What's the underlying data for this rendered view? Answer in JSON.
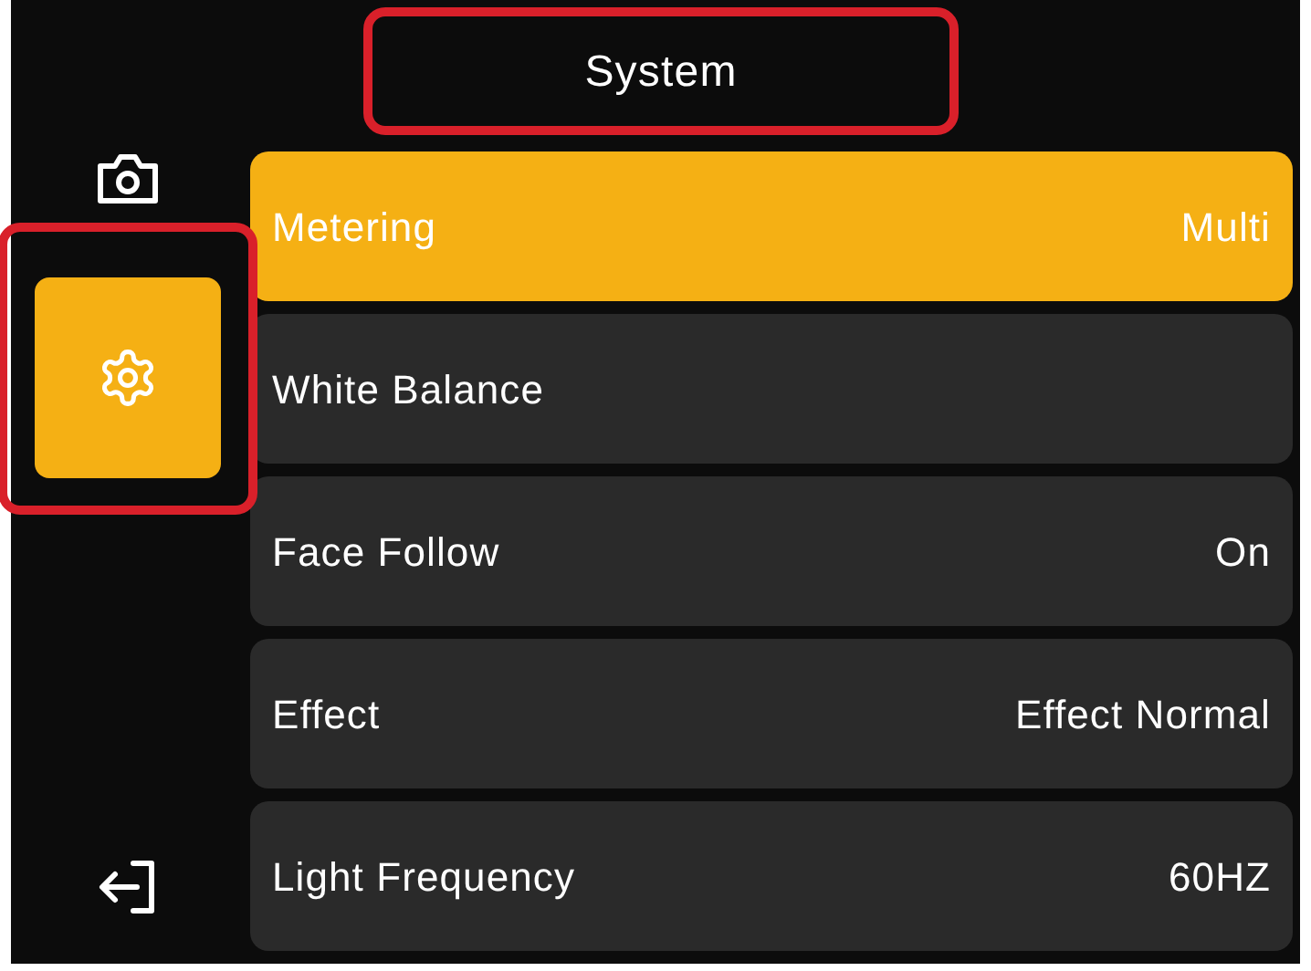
{
  "header": {
    "title": "System",
    "annotated": true
  },
  "sidebar": {
    "items": [
      {
        "kind": "camera",
        "selected": false,
        "annotated": false
      },
      {
        "kind": "settings",
        "selected": true,
        "annotated": true
      },
      {
        "kind": "exit",
        "selected": false,
        "annotated": false
      }
    ]
  },
  "rows": [
    {
      "label": "Metering",
      "value": "Multi",
      "selected": true
    },
    {
      "label": "White Balance",
      "selected": false
    },
    {
      "label": "Face Follow",
      "value": "On",
      "selected": false
    },
    {
      "label": "Effect",
      "value": "Effect Normal",
      "selected": false
    },
    {
      "label": "Light Frequency",
      "value": "60HZ",
      "selected": false
    }
  ]
}
